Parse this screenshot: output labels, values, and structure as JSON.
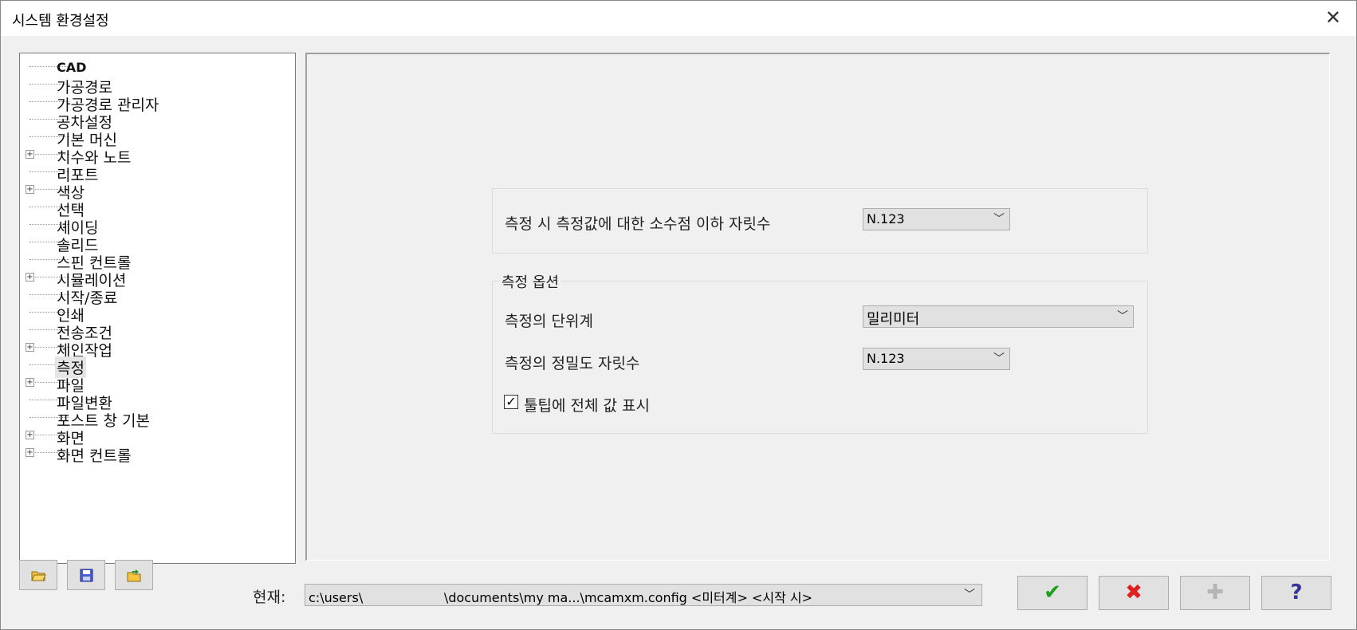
{
  "window": {
    "title": "시스템 환경설정",
    "close_glyph": "✕"
  },
  "tree": {
    "items": [
      {
        "label": "CAD",
        "expandable": false
      },
      {
        "label": "가공경로",
        "expandable": false
      },
      {
        "label": "가공경로 관리자",
        "expandable": false
      },
      {
        "label": "공차설정",
        "expandable": false
      },
      {
        "label": "기본 머신",
        "expandable": false
      },
      {
        "label": "치수와 노트",
        "expandable": true
      },
      {
        "label": "리포트",
        "expandable": false
      },
      {
        "label": "색상",
        "expandable": true
      },
      {
        "label": "선택",
        "expandable": false
      },
      {
        "label": "셰이딩",
        "expandable": false
      },
      {
        "label": "솔리드",
        "expandable": false
      },
      {
        "label": "스핀 컨트롤",
        "expandable": false
      },
      {
        "label": "시뮬레이션",
        "expandable": true
      },
      {
        "label": "시작/종료",
        "expandable": false
      },
      {
        "label": "인쇄",
        "expandable": false
      },
      {
        "label": "전송조건",
        "expandable": false
      },
      {
        "label": "체인작업",
        "expandable": true
      },
      {
        "label": "측정",
        "expandable": false,
        "selected": true
      },
      {
        "label": "파일",
        "expandable": true
      },
      {
        "label": "파일변환",
        "expandable": false
      },
      {
        "label": "포스트 창 기본",
        "expandable": false
      },
      {
        "label": "화면",
        "expandable": true
      },
      {
        "label": "화면 컨트롤",
        "expandable": true
      }
    ]
  },
  "measure": {
    "decimal_label": "측정 시 측정값에 대한 소수점 이하 자릿수",
    "decimal_value": "N.123",
    "options_title": "측정 옵션",
    "unit_label": "측정의 단위계",
    "unit_value": "밀리미터",
    "precision_label": "측정의 정밀도 자릿수",
    "precision_value": "N.123",
    "tooltip_label": "툴팁에 전체 값 표시",
    "tooltip_checked": true
  },
  "footer": {
    "current_label": "현재:",
    "current_path": "c:\\users\\                    \\documents\\my ma...\\mcamxm.config <미터계> <시작 시>",
    "icons": [
      "folder-open-icon",
      "save-icon",
      "merge-folder-icon"
    ],
    "ok_glyph": "✔",
    "cancel_glyph": "✖",
    "add_glyph": "✚",
    "help_glyph": "?",
    "colors": {
      "ok": "#1aa01a",
      "cancel": "#e02020",
      "add_disabled": "#b5b5b5",
      "help": "#333399"
    }
  }
}
